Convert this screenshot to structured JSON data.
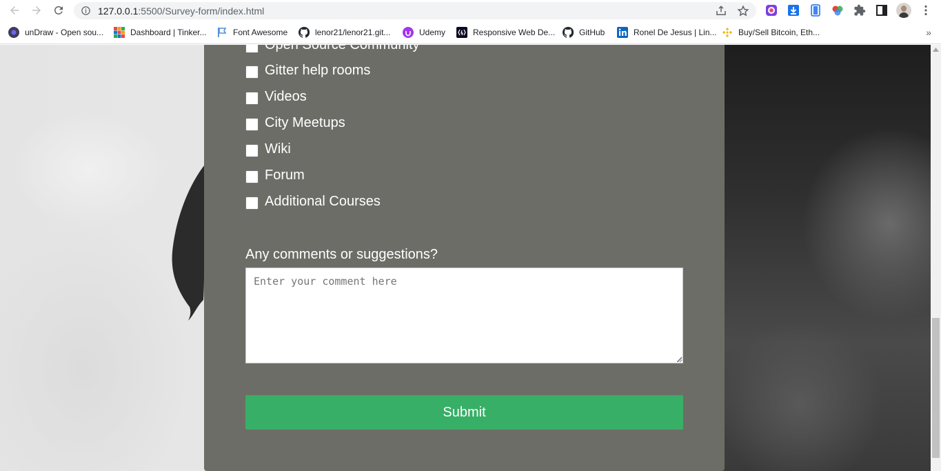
{
  "browser": {
    "url_host": "127.0.0.1",
    "url_path": ":5500/Survey-form/index.html"
  },
  "bookmarks": [
    {
      "label": "unDraw - Open sou...",
      "icon": "undraw-icon",
      "color": "#3f3d56"
    },
    {
      "label": "Dashboard | Tinker...",
      "icon": "tinkercad-icon",
      "color": "#1477d1"
    },
    {
      "label": "Font Awesome",
      "icon": "font-awesome-flag-icon",
      "color": "#528dd7"
    },
    {
      "label": "lenor21/lenor21.git...",
      "icon": "github-icon",
      "color": "#24292f"
    },
    {
      "label": "Udemy",
      "icon": "udemy-icon",
      "color": "#a435f0"
    },
    {
      "label": "Responsive Web De...",
      "icon": "freecodecamp-icon",
      "color": "#0a0a23"
    },
    {
      "label": "GitHub",
      "icon": "github-icon",
      "color": "#24292f"
    },
    {
      "label": "Ronel De Jesus | Lin...",
      "icon": "linkedin-icon",
      "color": "#0a66c2"
    },
    {
      "label": "Buy/Sell Bitcoin, Eth...",
      "icon": "binance-icon",
      "color": "#f0b90b"
    }
  ],
  "form": {
    "partial_option": "Open Source Community",
    "options": [
      "Gitter help rooms",
      "Videos",
      "City Meetups",
      "Wiki",
      "Forum",
      "Additional Courses"
    ],
    "comment_label": "Any comments or suggestions?",
    "comment_placeholder": "Enter your comment here",
    "submit_label": "Submit"
  },
  "colors": {
    "form_panel": "#6d6d67",
    "submit": "#37af66"
  }
}
